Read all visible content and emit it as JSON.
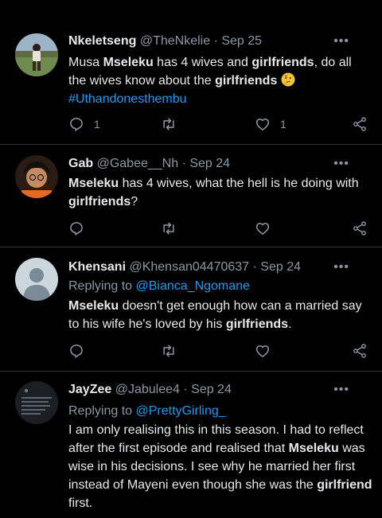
{
  "tweets": [
    {
      "name": "Nkeletseng",
      "handle": "@TheNkelie",
      "sep": "·",
      "date": "Sep 25",
      "more": "•••",
      "body_parts": [
        "Musa ",
        "Mseleku",
        " has 4 wives and ",
        "girlfriends",
        ", do all the wives know about the ",
        "girlfriends",
        "#Uthandonesthembu"
      ],
      "emoji": "thinking-face",
      "reply_count": "1",
      "retweet_count": "",
      "like_count": "1"
    },
    {
      "name": "Gab",
      "handle": "@Gabee__Nh",
      "sep": "·",
      "date": "Sep 24",
      "more": "•••",
      "body_parts": [
        "Mseleku",
        " has 4 wives, what the hell is he doing with ",
        "girlfriends",
        "?"
      ]
    },
    {
      "name": "Khensani",
      "handle": "@Khensan04470637",
      "sep": "·",
      "date": "Sep 24",
      "more": "•••",
      "replying_prefix": "Replying to ",
      "replying_to": "@Bianca_Ngomane",
      "body_parts": [
        "Mseleku",
        " doesn't get enough how can a married say to his wife he's loved by his ",
        "girlfriends",
        "."
      ]
    },
    {
      "name": "JayZee",
      "handle": "@Jabulee4",
      "sep": "·",
      "date": "Sep 24",
      "more": "•••",
      "replying_prefix": "Replying to ",
      "replying_to": "@PrettyGirling_",
      "body_parts": [
        "I am only realising this in this season. I had to reflect after the first episode and realised that ",
        "Mseleku",
        " was wise in his decisions. I see why he married her first instead of Mayeni even though she was the ",
        "girlfriend",
        " first."
      ]
    }
  ],
  "colors": {
    "background": "#000000",
    "text": "#e7e9ea",
    "secondary": "#8b98a5",
    "link": "#1d9bf0",
    "divider": "#2f3336"
  },
  "icons": [
    "reply-icon",
    "retweet-icon",
    "like-icon",
    "share-icon",
    "more-icon",
    "thinking-face-emoji"
  ]
}
